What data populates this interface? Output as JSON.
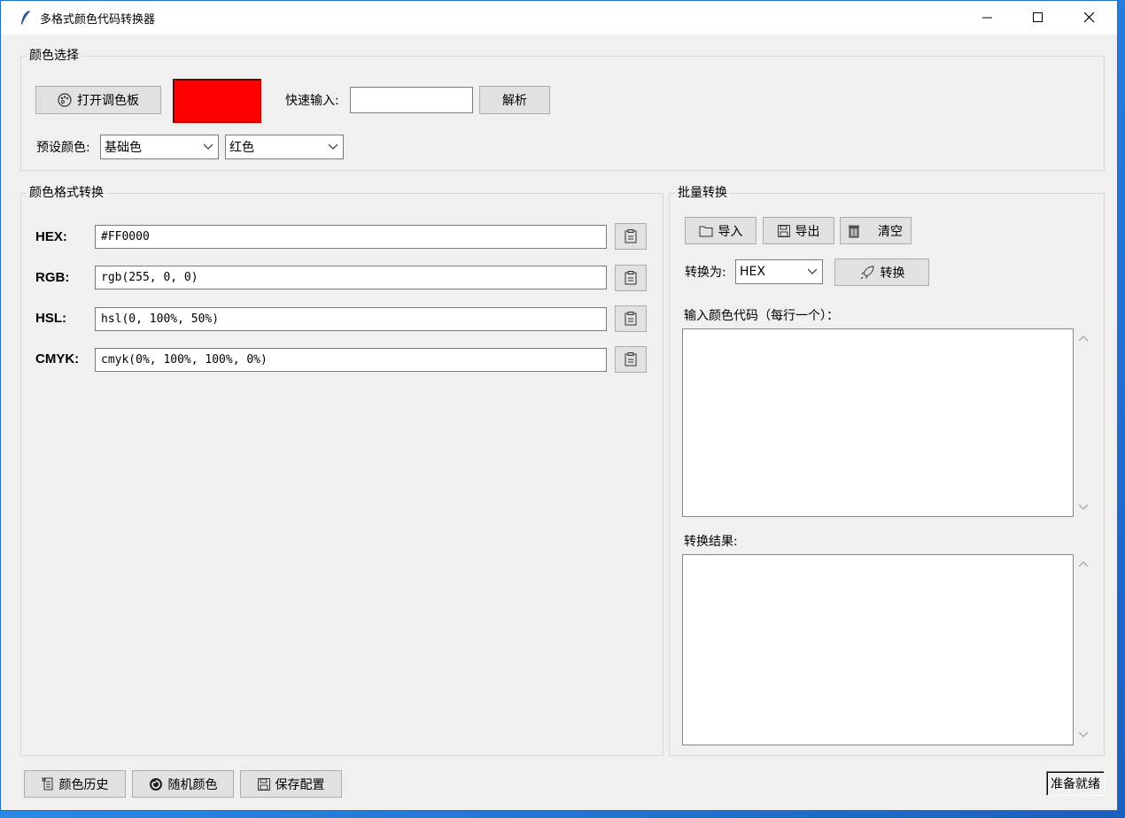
{
  "window": {
    "title": "多格式颜色代码转换器"
  },
  "color_select": {
    "group_label": "颜色选择",
    "open_palette_label": "打开调色板",
    "swatch_color": "#FF0000",
    "quick_input_label": "快速输入:",
    "quick_input_value": "",
    "parse_label": "解析",
    "preset_label": "预设颜色:",
    "preset_category": "基础色",
    "preset_color": "红色"
  },
  "format_convert": {
    "group_label": "颜色格式转换",
    "rows": [
      {
        "label": "HEX:",
        "value": "#FF0000"
      },
      {
        "label": "RGB:",
        "value": "rgb(255, 0, 0)"
      },
      {
        "label": "HSL:",
        "value": "hsl(0, 100%, 50%)"
      },
      {
        "label": "CMYK:",
        "value": "cmyk(0%, 100%, 100%, 0%)"
      }
    ]
  },
  "batch": {
    "group_label": "批量转换",
    "import_label": "导入",
    "export_label": "导出",
    "clear_label": "清空",
    "convert_to_label": "转换为:",
    "convert_to_value": "HEX",
    "convert_label": "转换",
    "input_label": "输入颜色代码（每行一个）：",
    "result_label": "转换结果:"
  },
  "bottom": {
    "history_label": "颜色历史",
    "random_label": "随机颜色",
    "save_label": "保存配置",
    "status": "准备就绪"
  }
}
